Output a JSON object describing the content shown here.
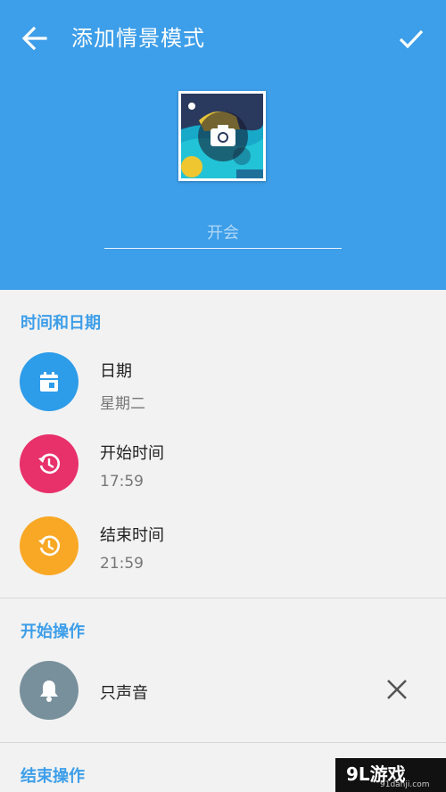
{
  "header": {
    "title": "添加情景模式",
    "back_icon": "arrow-left-icon",
    "confirm_icon": "check-icon",
    "cover_icon": "camera-icon",
    "name_placeholder": "开会",
    "name_value": "",
    "background_color": "#3d9ee9"
  },
  "time_section": {
    "title": "时间和日期",
    "rows": [
      {
        "label": "日期",
        "value": "星期二",
        "icon": "calendar-icon",
        "color": "#2d9ce9"
      },
      {
        "label": "开始时间",
        "value": "17:59",
        "icon": "history-icon",
        "color": "#e8306a"
      },
      {
        "label": "结束时间",
        "value": "21:59",
        "icon": "history-icon",
        "color": "#f9a825"
      }
    ]
  },
  "start_section": {
    "title": "开始操作",
    "action": {
      "label": "只声音",
      "icon": "bell-icon",
      "color": "#78909c",
      "remove_icon": "close-icon"
    }
  },
  "end_section": {
    "title": "结束操作"
  },
  "watermark": {
    "logo": "9L游戏",
    "site": "91danji.com"
  }
}
